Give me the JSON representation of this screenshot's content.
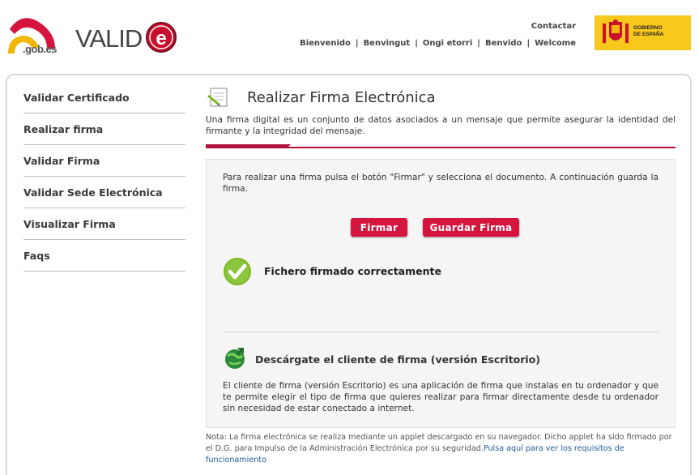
{
  "header": {
    "gob_logo_text": ".gob.es",
    "valide_logo_text": "VALID",
    "contact_label": "Contactar",
    "languages": [
      "Bienvenido",
      "Benvingut",
      "Ongi etorri",
      "Benvido",
      "Welcome"
    ],
    "gobierno_line1": "GOBIERNO",
    "gobierno_line2": "DE ESPAÑA"
  },
  "sidebar": {
    "items": [
      {
        "label": "Validar Certificado"
      },
      {
        "label": "Realizar firma"
      },
      {
        "label": "Validar Firma"
      },
      {
        "label": "Validar Sede Electrónica"
      },
      {
        "label": "Visualizar Firma"
      },
      {
        "label": "Faqs"
      }
    ]
  },
  "main": {
    "title": "Realizar Firma Electrónica",
    "intro": "Una firma digital es un conjunto de datos asociados a un mensaje que permite asegurar la identidad del firmante y la integridad del mensaje.",
    "instructions": "Para realizar una firma pulsa el botón \"Firmar\" y selecciona el documento. A continuación guarda la firma.",
    "sign_button": "Firmar",
    "save_button": "Guardar Firma",
    "status_message": "Fichero firmado correctamente",
    "download_title": "Descárgate el cliente de firma (versión Escritorio)",
    "download_desc": "El cliente de firma (versión Escritorio) es una aplicación de firma que instalas en tu ordenador y que te permite elegir el tipo de firma que quieres realizar para firmar directamente desde tu ordenador sin necesidad de estar conectado a internet.",
    "note_text": "Nota: La firma electrónica se realiza mediante un applet descargado en su navegador. Dicho applet ha sido firmado por el D.G. para Impulso de la Administración Electrónica por su seguridad.",
    "note_link": "Pulsa aquí para ver los requisitos de funcionamiento"
  },
  "colors": {
    "accent_red": "#d6153f",
    "bar_red": "#b0103a",
    "link_blue": "#1f5a96",
    "success_green": "#7ab61e",
    "gobierno_yellow": "#f8c81c"
  }
}
